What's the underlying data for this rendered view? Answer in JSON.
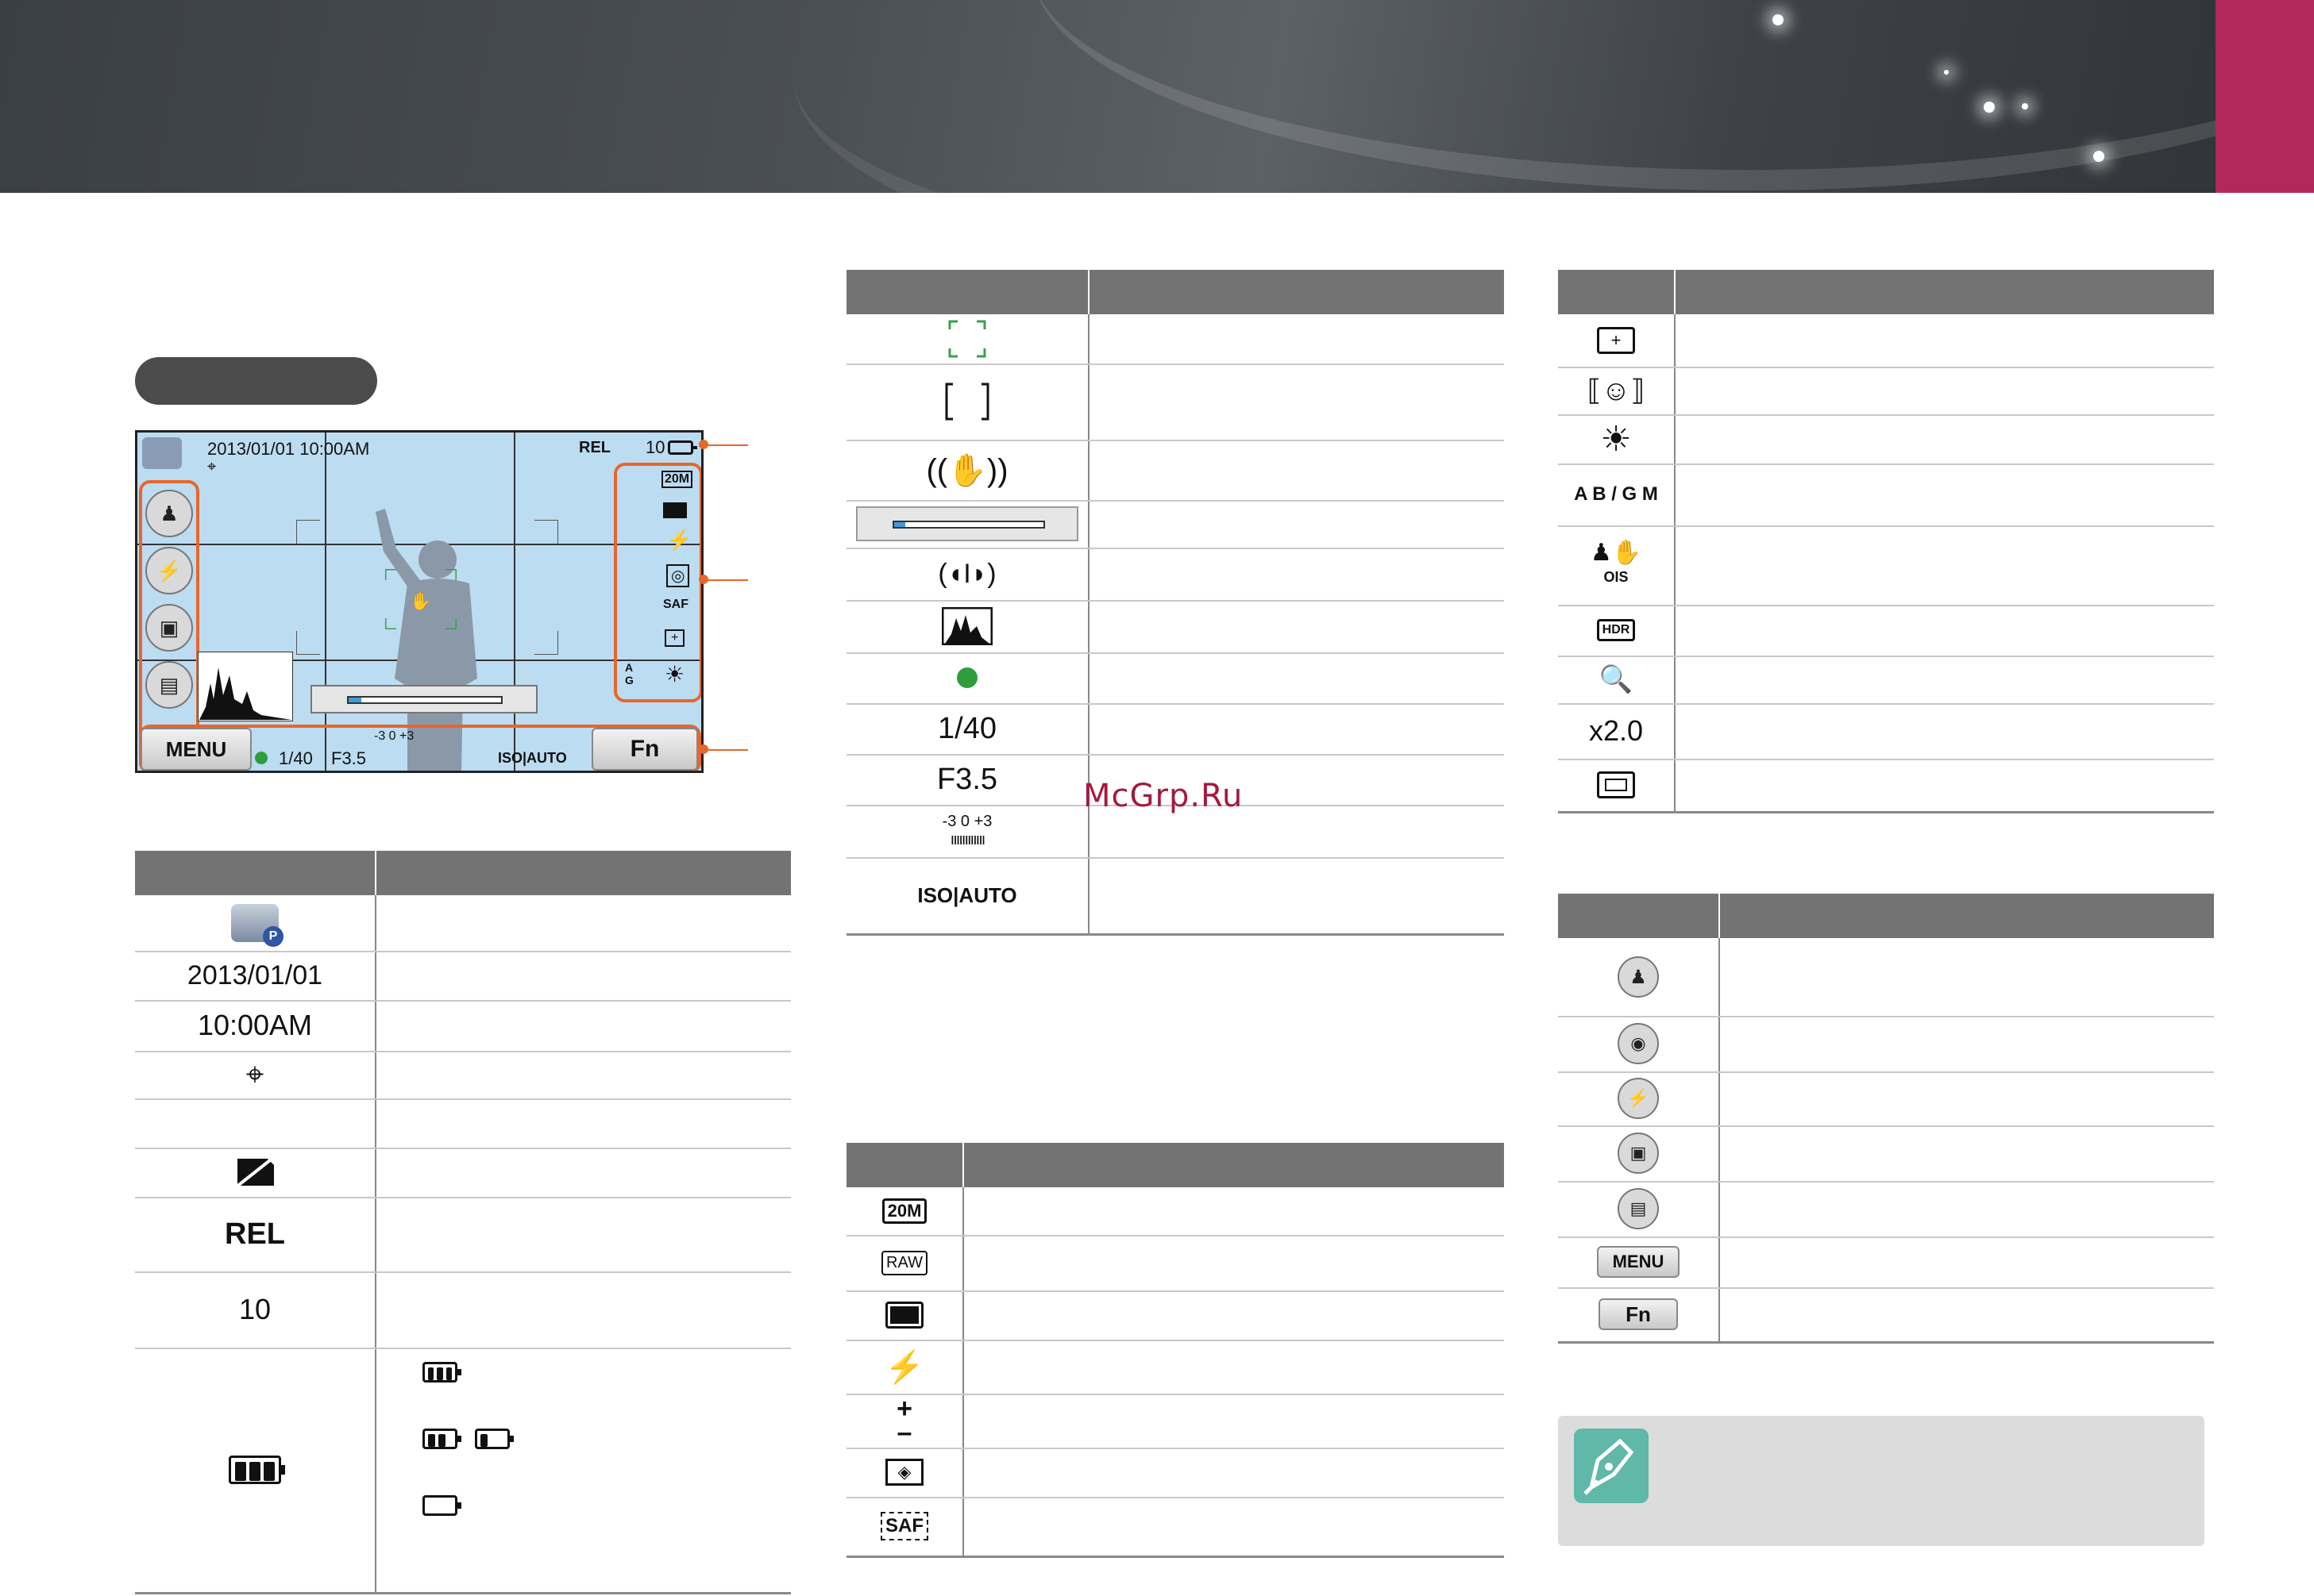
{
  "screen": {
    "datetime": "2013/01/01 10:00AM",
    "rel": "REL",
    "shots": "10",
    "menu_label": "MENU",
    "fn_label": "Fn",
    "shutter": "1/40",
    "aperture": "F3.5",
    "ev_scale": "-3    0    +3",
    "iso": "ISO|AUTO"
  },
  "table1": {
    "rows": [
      {
        "icon": "camera-p-icon"
      },
      {
        "text": "2013/01/01"
      },
      {
        "text": "10:00AM"
      },
      {
        "icon": "gps-icon"
      },
      {
        "text": ""
      },
      {
        "icon": "card-off-icon"
      },
      {
        "text": "REL"
      },
      {
        "text": "10"
      },
      {
        "icon": "battery-icon"
      }
    ]
  },
  "table2": {
    "rows": [
      {
        "icon": "af-frame-icon"
      },
      {
        "icon": "af-bracket-icon"
      },
      {
        "icon": "shake-warning-icon"
      },
      {
        "icon": "zoom-bar-icon"
      },
      {
        "icon": "level-icon"
      },
      {
        "icon": "histogram-icon"
      },
      {
        "icon": "focus-dot-icon"
      },
      {
        "text": "1/40"
      },
      {
        "text": "F3.5"
      },
      {
        "text": "-3  0  +3"
      },
      {
        "text": "ISO|AUTO"
      }
    ]
  },
  "table3": {
    "rows": [
      {
        "text": "20M"
      },
      {
        "text": "RAW"
      },
      {
        "icon": "ratio-icon"
      },
      {
        "icon": "flash-icon"
      },
      {
        "text": "+ / –"
      },
      {
        "icon": "metering-icon"
      },
      {
        "text": "SAF"
      }
    ]
  },
  "table4": {
    "rows": [
      {
        "icon": "spot-icon"
      },
      {
        "icon": "face-detect-icon"
      },
      {
        "icon": "sun-icon"
      },
      {
        "text": "A  B / G  M"
      },
      {
        "icon": "ois-icon"
      },
      {
        "text": "HDR"
      },
      {
        "icon": "smart-zoom-icon"
      },
      {
        "text": "x2.0"
      },
      {
        "icon": "display-icon"
      }
    ]
  },
  "table5": {
    "rows": [
      {
        "icon": "scene-icon"
      },
      {
        "icon": "selftimer-icon"
      },
      {
        "icon": "flash-off-icon"
      },
      {
        "icon": "touch-icon"
      },
      {
        "icon": "display-mode-icon"
      },
      {
        "text": "MENU"
      },
      {
        "text": "Fn"
      }
    ]
  },
  "watermark": "McGrp.Ru"
}
